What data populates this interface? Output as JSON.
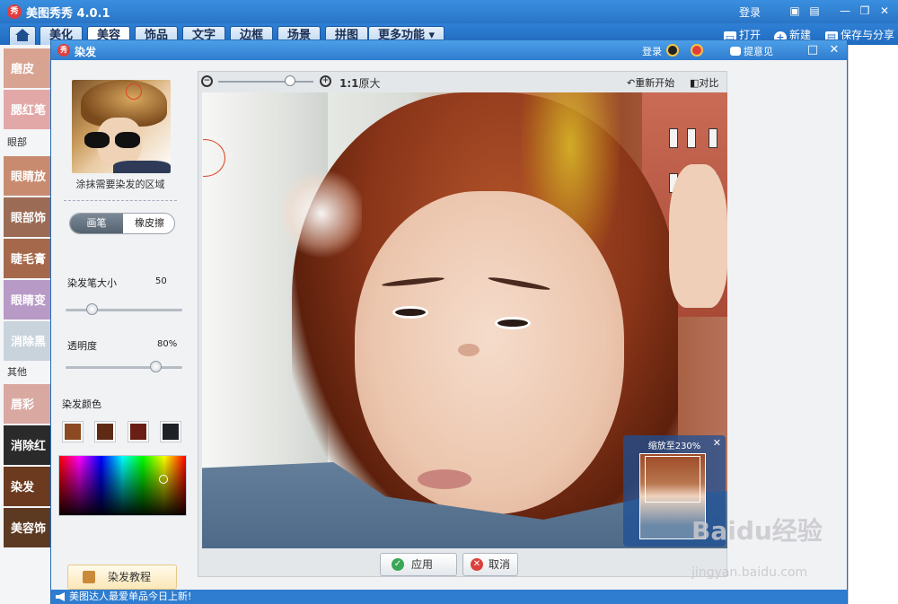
{
  "app": {
    "title": "美图秀秀 4.0.1",
    "logo_text": "秀",
    "login": "登录",
    "window_buttons": [
      "feedback",
      "skin",
      "minimize",
      "restore",
      "close"
    ]
  },
  "tabs": [
    "美化",
    "美容",
    "饰品",
    "文字",
    "边框",
    "场景",
    "拼图",
    "更多功能 ▾"
  ],
  "active_tab": "美容",
  "toolbar_right": {
    "open": "打开",
    "new": "新建",
    "save_share": "保存与分享"
  },
  "left_strip": {
    "items": [
      {
        "label": "磨皮",
        "color": "#d8a391"
      },
      {
        "label": "腮红笔",
        "color": "#e2a8a8"
      }
    ],
    "section_eye": "眼部",
    "eye_items": [
      {
        "label": "眼睛放",
        "color": "#c88b70"
      },
      {
        "label": "眼部饰",
        "color": "#9b6b55"
      },
      {
        "label": "睫毛膏",
        "color": "#a5684b"
      },
      {
        "label": "眼睛变",
        "color": "#b89ac6"
      },
      {
        "label": "消除黑",
        "color": "#c9d3db"
      }
    ],
    "section_other": "其他",
    "other_items": [
      {
        "label": "唇彩",
        "color": "#d9a8a0"
      },
      {
        "label": "消除红",
        "color": "#2a2a2a"
      },
      {
        "label": "染发",
        "color": "#6b3a1f"
      },
      {
        "label": "美容饰",
        "color": "#5c3a22"
      }
    ]
  },
  "dialog": {
    "title": "染发",
    "login": "登录",
    "feedback": "提意见",
    "hint": "涂抹需要染发的区域",
    "mode_brush": "画笔",
    "mode_eraser": "橡皮擦",
    "brush_size_label": "染发笔大小",
    "brush_size_value": "50",
    "brush_size_level": 0.2,
    "opacity_label": "透明度",
    "opacity_value": "80%",
    "opacity_level": 0.8,
    "color_label": "染发颜色",
    "swatches": [
      "#8b4a22",
      "#5e2a14",
      "#6a1f14",
      "#1e2126"
    ],
    "tutorial": "染发教程",
    "zoom_ratio": "1:1",
    "zoom_original": "原大",
    "reset": "重新开始",
    "compare": "对比",
    "navigator_label": "缩放至230%",
    "apply": "应用",
    "cancel": "取消",
    "status": "美图达人最爱单品今日上新!"
  },
  "watermark": {
    "brand": "Baidu经验",
    "url": "jingyan.baidu.com"
  }
}
